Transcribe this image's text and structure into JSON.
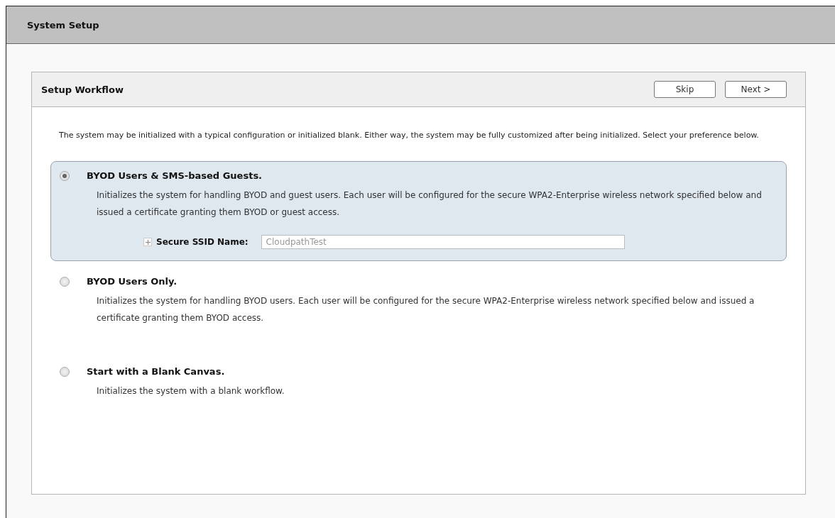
{
  "window": {
    "title": "System Setup"
  },
  "panel": {
    "title": "Setup Workflow",
    "buttons": [
      {
        "label": "Skip"
      },
      {
        "label": "Next >"
      }
    ],
    "intro": "The system may be initialized with a typical configuration or initialized blank. Either way, the system may be fully customized after being initialized. Select your preference below.",
    "options": [
      {
        "title": "BYOD Users & SMS-based Guests.",
        "selected": true,
        "description": "Initializes the system for handling BYOD and guest users. Each user will be configured for the secure WPA2-Enterprise wireless network specified below and issued a certificate granting them BYOD or guest access.",
        "field": {
          "label": "Secure SSID Name:",
          "placeholder": "CloudpathTest",
          "expanded": false
        }
      },
      {
        "title": "BYOD Users Only.",
        "selected": false,
        "description": "Initializes the system for handling BYOD users. Each user will be configured for the secure WPA2-Enterprise wireless network specified below and issued a certificate granting them BYOD access."
      },
      {
        "title": "Start with a Blank Canvas.",
        "selected": false,
        "description": "Initializes the system with a blank workflow."
      }
    ]
  }
}
